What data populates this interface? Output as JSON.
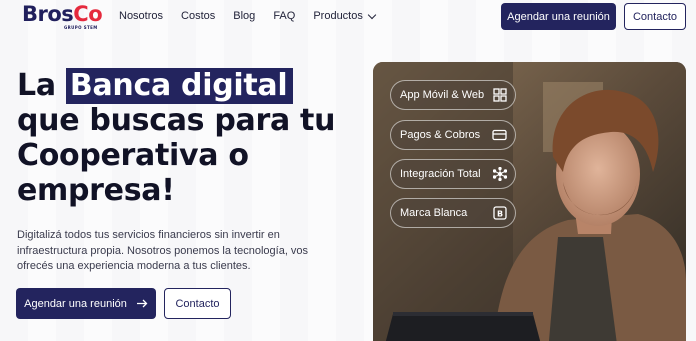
{
  "logo": {
    "part1": "Bros",
    "part2": "Co",
    "sub": "GRUPO STEM"
  },
  "nav": {
    "items": [
      {
        "label": "Nosotros"
      },
      {
        "label": "Costos"
      },
      {
        "label": "Blog"
      },
      {
        "label": "FAQ"
      },
      {
        "label": "Productos"
      }
    ],
    "cta_primary": "Agendar una reunión",
    "cta_secondary": "Contacto"
  },
  "hero": {
    "headline_pre": "La ",
    "headline_highlight": "Banca digital",
    "headline_post": " que buscas para tu Cooperativa o empresa!",
    "description": "Digitalizá todos tus servicios financieros sin invertir en infraestructura propia. Nosotros ponemos la tecnología, vos ofrecés una experiencia moderna a tus clientes.",
    "cta_primary": "Agendar una reunión",
    "cta_secondary": "Contacto"
  },
  "features": [
    {
      "label": "App Móvil & Web",
      "icon": "grid-icon"
    },
    {
      "label": "Pagos & Cobros",
      "icon": "card-icon"
    },
    {
      "label": "Integración Total",
      "icon": "network-icon"
    },
    {
      "label": "Marca Blanca",
      "icon": "badge-b-icon"
    }
  ],
  "colors": {
    "brand_navy": "#23245e",
    "brand_red": "#e5293d"
  }
}
